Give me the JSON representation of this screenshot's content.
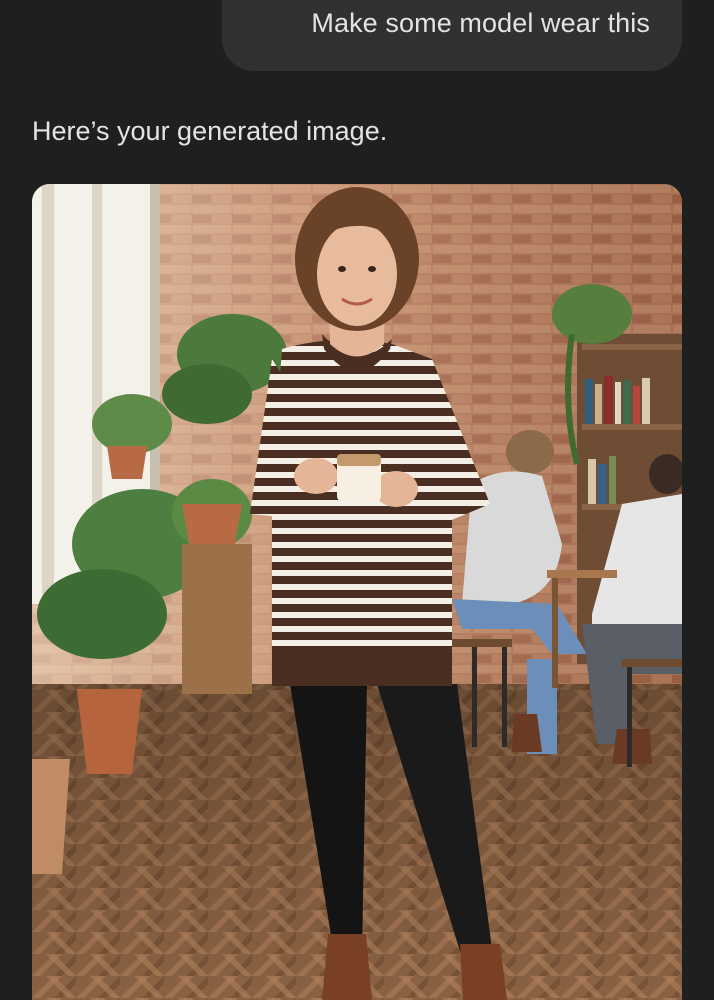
{
  "conversation": {
    "user_message": "Make some model wear this",
    "assistant_reply": "Here’s your generated image."
  },
  "generated_image": {
    "subject": "woman in striped sweater dress holding coffee"
  }
}
